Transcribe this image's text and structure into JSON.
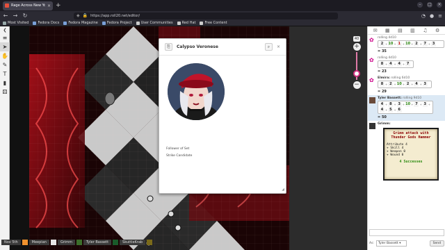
{
  "browser": {
    "tab_title": "Rage Across New York",
    "url": "https://app.roll20.net/editor/",
    "bookmarks": [
      "Most Visited",
      "Fedora Docs",
      "Fedora Magazine",
      "Fedora Project",
      "User Communities",
      "Red Hat",
      "Free Content"
    ]
  },
  "zoom": {
    "level": "40",
    "plus": "+",
    "minus": "−"
  },
  "popup": {
    "name": "Calypso Veronese",
    "lines": [
      "Follower of Set",
      "Strike Candidate"
    ]
  },
  "players": [
    {
      "name": "Nov 5th",
      "color": "#f0922e"
    },
    {
      "name": "Meepian",
      "color": "#e7e7e7"
    },
    {
      "name": "Grimm",
      "color": "#3b6e2a"
    },
    {
      "name": "Tyler Bassett",
      "color": "#1a5a2a"
    },
    {
      "name": "SkuttleKrab",
      "color": "#7a6a1a"
    }
  ],
  "chat": {
    "messages": [
      {
        "roll": "rolling 4d10",
        "dice": [
          "2",
          "10",
          "1",
          "10",
          "2",
          "7",
          "3"
        ],
        "result": "35"
      },
      {
        "roll": "rolling 4d10",
        "dice": [
          "8",
          "4",
          "4",
          "7"
        ],
        "result": "23"
      },
      {
        "who": "Elmira:",
        "roll": "rolling 6d10",
        "dice": [
          "8",
          "2",
          "10",
          "2",
          "4",
          "3"
        ],
        "result": "29"
      },
      {
        "who": "Tyler Bassett:",
        "roll": "rolling 9d10",
        "dice": [
          "4",
          "8",
          "3",
          "10",
          "7",
          "3",
          "4",
          "5",
          "6"
        ],
        "result": "50"
      },
      {
        "who": "Grimm:"
      }
    ],
    "card": {
      "title": "Grimm attack with Thunder Gods Hammer",
      "lines": [
        "Attribute 4",
        "+ Skill 4",
        "+ Weapon 0",
        "+ Wound 0"
      ],
      "result": "4 Successes"
    },
    "as_label": "As:",
    "as_value": "Tyler Bassett",
    "send_label": "Send"
  }
}
